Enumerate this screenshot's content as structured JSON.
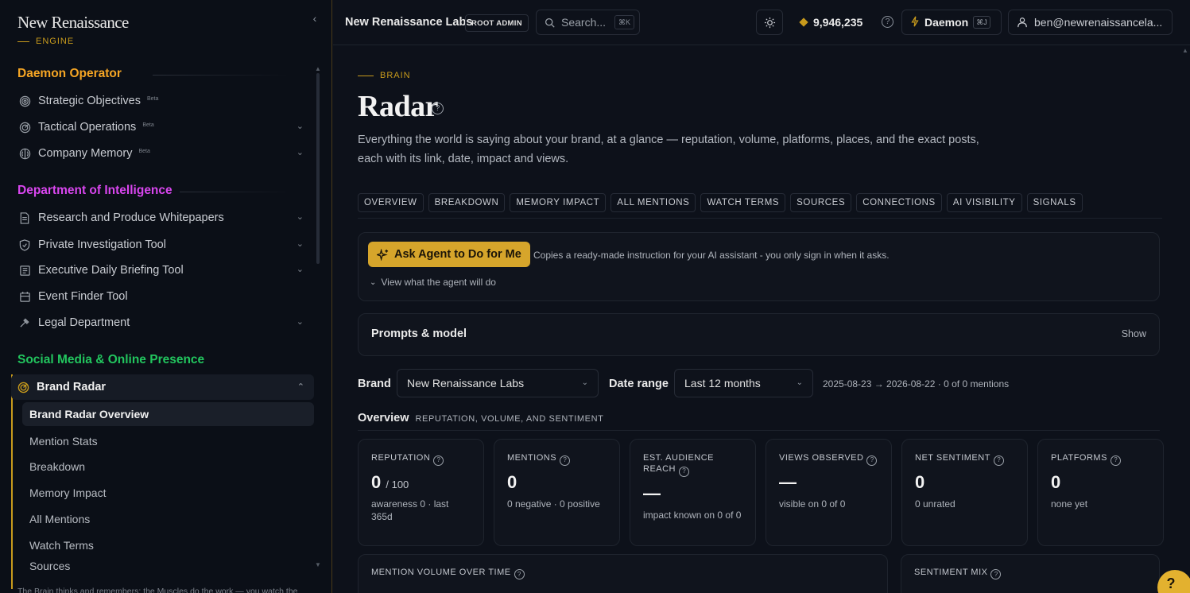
{
  "logo": {
    "title": "New Renaissance",
    "subtitle": "ENGINE"
  },
  "colors": {
    "accent": "#c79a1c",
    "daemon_operator": "#f5a524",
    "intelligence": "#d946ef",
    "social": "#22c55e"
  },
  "sidebar": {
    "sections": [
      {
        "title": "Daemon Operator",
        "items": [
          {
            "label": "Strategic Objectives",
            "badge": "Beta",
            "icon": "target-icon"
          },
          {
            "label": "Tactical Operations",
            "badge": "Beta",
            "icon": "radar-icon"
          },
          {
            "label": "Company Memory",
            "badge": "Beta",
            "icon": "brain-icon"
          }
        ]
      },
      {
        "title": "Department of Intelligence",
        "items": [
          {
            "label": "Research and Produce Whitepapers",
            "icon": "document-icon"
          },
          {
            "label": "Private Investigation Tool",
            "icon": "shield-icon"
          },
          {
            "label": "Executive Daily Briefing Tool",
            "icon": "newspaper-icon"
          },
          {
            "label": "Event Finder Tool",
            "icon": "calendar-icon"
          },
          {
            "label": "Legal Department",
            "icon": "gavel-icon"
          }
        ]
      },
      {
        "title": "Social Media & Online Presence",
        "group": {
          "label": "Brand Radar",
          "icon": "radar-icon"
        },
        "subitems": [
          "Brand Radar Overview",
          "Mention Stats",
          "Breakdown",
          "Memory Impact",
          "All Mentions",
          "Watch Terms",
          "Sources"
        ]
      }
    ],
    "footer": "The Brain thinks and remembers; the Muscles do the work — you watch the"
  },
  "topbar": {
    "org": "New Renaissance Labs",
    "role_badge": "ROOT ADMIN",
    "search_placeholder": "Search...",
    "search_shortcut": "⌘K",
    "credits": "9,946,235",
    "daemon_label": "Daemon",
    "daemon_shortcut": "⌘J",
    "user_email": "ben@newrenaissancela..."
  },
  "page": {
    "kicker": "BRAIN",
    "title": "Radar",
    "description": "Everything the world is saying about your brand, at a glance — reputation, volume, platforms, places, and the exact posts, each with its link, date, impact and views.",
    "tabs": [
      "OVERVIEW",
      "BREAKDOWN",
      "MEMORY IMPACT",
      "ALL MENTIONS",
      "WATCH TERMS",
      "SOURCES",
      "CONNECTIONS",
      "AI VISIBILITY",
      "SIGNALS"
    ]
  },
  "agent": {
    "button_label": "Ask Agent to Do for Me",
    "note": "Copies a ready-made instruction for your AI assistant - you only sign in when it asks.",
    "expand_label": "View what the agent will do"
  },
  "prompts": {
    "title": "Prompts & model",
    "toggle": "Show"
  },
  "filters": {
    "brand_label": "Brand",
    "brand_value": "New Renaissance Labs",
    "range_label": "Date range",
    "range_value": "Last 12 months",
    "range_text": "2025-08-23 → 2026-08-22 · 0 of 0 mentions"
  },
  "overview": {
    "title": "Overview",
    "subtitle": "REPUTATION, VOLUME, AND SENTIMENT",
    "stats": [
      {
        "label": "REPUTATION",
        "value": "0",
        "denominator": "/ 100",
        "sub": "awareness 0 · last 365d"
      },
      {
        "label": "MENTIONS",
        "value": "0",
        "denominator": "",
        "sub": "0 negative · 0 positive"
      },
      {
        "label": "EST. AUDIENCE REACH",
        "value": "—",
        "denominator": "",
        "sub": "impact known on 0 of 0"
      },
      {
        "label": "VIEWS OBSERVED",
        "value": "—",
        "denominator": "",
        "sub": "visible on 0 of 0"
      },
      {
        "label": "NET SENTIMENT",
        "value": "0",
        "denominator": "",
        "sub": "0 unrated"
      },
      {
        "label": "PLATFORMS",
        "value": "0",
        "denominator": "",
        "sub": "none yet"
      }
    ]
  },
  "charts": {
    "volume_title": "MENTION VOLUME OVER TIME",
    "sentiment_title": "SENTIMENT MIX"
  }
}
